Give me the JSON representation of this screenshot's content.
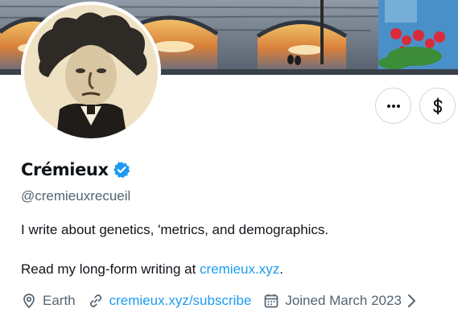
{
  "profile": {
    "display_name": "Crémieux",
    "handle": "@cremieuxrecueil",
    "verified": true,
    "bio": {
      "line1": "I write about genetics, 'metrics, and demographics.",
      "line2_prefix": "Read my long-form writing at ",
      "line2_link": "cremieux.xyz",
      "line2_suffix": "."
    },
    "meta": {
      "location": "Earth",
      "website": "cremieux.xyz/subscribe",
      "joined": "Joined March 2023"
    }
  },
  "actions": {
    "more_icon": "ellipsis-icon",
    "tip_icon": "dollar-icon"
  },
  "colors": {
    "accent": "#1d9bf0",
    "text_primary": "#0f1419",
    "text_secondary": "#536471",
    "border": "#cfd9de"
  }
}
